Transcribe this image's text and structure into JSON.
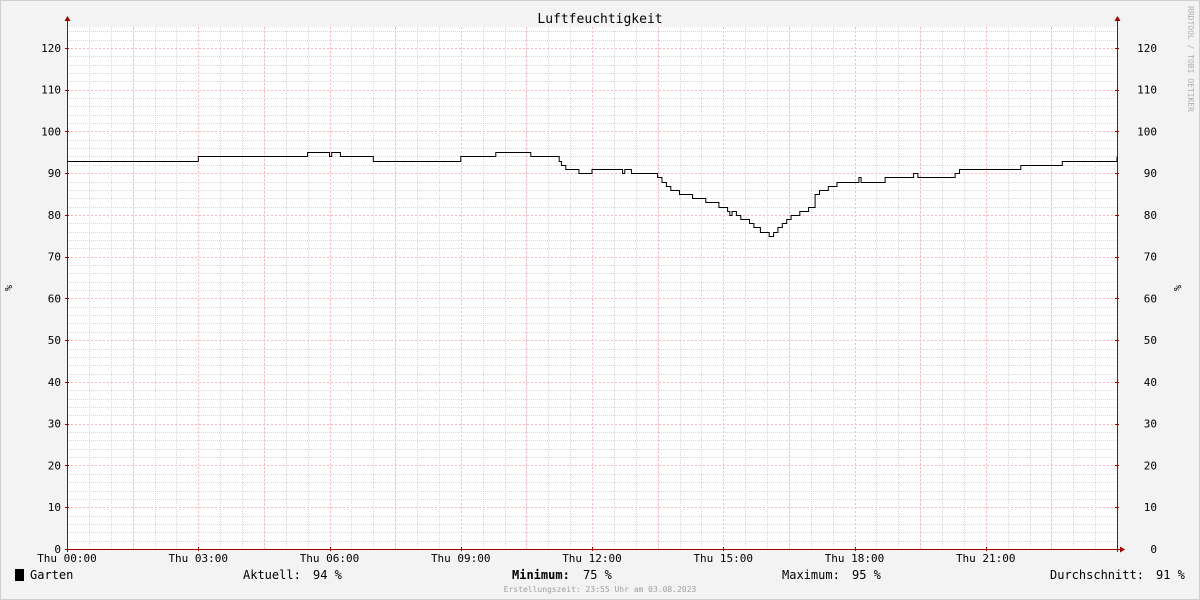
{
  "chart_data": {
    "type": "line",
    "title": "Luftfeuchtigkeit",
    "ylabel_left": "%",
    "ylabel_right": "%",
    "ylim": [
      0,
      125
    ],
    "yticks": [
      0,
      10,
      20,
      30,
      40,
      50,
      60,
      70,
      80,
      90,
      100,
      110,
      120
    ],
    "ytick_labels": [
      "0",
      "10",
      "20",
      "30",
      "40",
      "50",
      "60",
      "70",
      "80",
      "90",
      "100",
      "110",
      "120"
    ],
    "xlim": [
      0,
      24
    ],
    "xticks": [
      0,
      3,
      6,
      9,
      12,
      15,
      18,
      21
    ],
    "xtick_labels": [
      "Thu 00:00",
      "Thu 03:00",
      "Thu 06:00",
      "Thu 09:00",
      "Thu 12:00",
      "Thu 15:00",
      "Thu 18:00",
      "Thu 21:00"
    ],
    "grid": true,
    "watermark": "RRDTOOL / TOBI OETIKER",
    "series": [
      {
        "name": "Garten",
        "color": "#000000",
        "step": true,
        "x": [
          0,
          3,
          5.5,
          6.0,
          6.05,
          6.15,
          6.25,
          7,
          9,
          9.8,
          10.6,
          11.25,
          11.3,
          11.4,
          11.7,
          12.0,
          12.7,
          12.75,
          12.9,
          13.5,
          13.6,
          13.7,
          13.8,
          14.0,
          14.3,
          14.6,
          14.9,
          15.1,
          15.15,
          15.2,
          15.3,
          15.4,
          15.6,
          15.7,
          15.85,
          16.0,
          16.05,
          16.15,
          16.25,
          16.35,
          16.45,
          16.55,
          16.75,
          16.95,
          17.1,
          17.2,
          17.4,
          17.6,
          17.7,
          17.8,
          18.1,
          18.15,
          18.7,
          18.95,
          19.35,
          19.45,
          20.3,
          20.4,
          21.0,
          21.8,
          22.75,
          24
        ],
        "y": [
          93,
          94,
          95,
          94,
          95,
          95,
          94,
          93,
          94,
          95,
          94,
          93,
          92,
          91,
          90,
          91,
          90,
          91,
          90,
          89,
          88,
          87,
          86,
          85,
          84,
          83,
          82,
          81,
          80,
          81,
          80,
          79,
          78,
          77,
          76,
          76,
          75,
          76,
          77,
          78,
          79,
          80,
          81,
          82,
          85,
          86,
          87,
          88,
          88,
          88,
          89,
          88,
          89,
          89,
          90,
          89,
          90,
          91,
          91,
          92,
          93,
          94
        ]
      }
    ],
    "legend": {
      "position": "bottom",
      "swatch_color": "#000000",
      "name": "Garten",
      "stats": [
        {
          "label": "Aktuell:",
          "value": "94 %"
        },
        {
          "label": "Minimum:",
          "value": "75 %"
        },
        {
          "label": "Maximum:",
          "value": "95 %"
        },
        {
          "label": "Durchschnitt:",
          "value": "91 %"
        }
      ]
    },
    "footer": "Erstellungszeit: 23:55 Uhr am 03.08.2023",
    "colors": {
      "background": "#f3f3f3",
      "plot_background": "#ffffff",
      "major_grid": "#ffb6c1",
      "minor_grid": "#d8d8d8",
      "axis": "#a00000",
      "line": "#000000"
    }
  }
}
